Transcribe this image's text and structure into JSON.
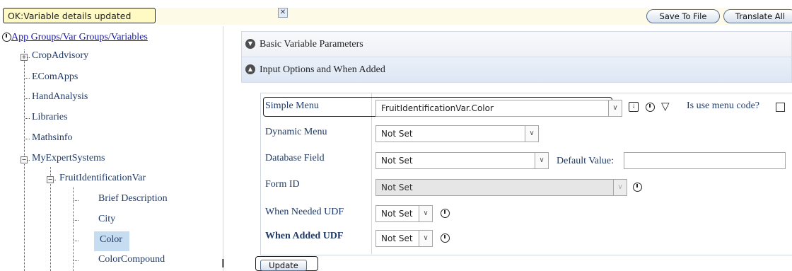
{
  "status": {
    "message": "OK:Variable details updated",
    "close_icon": "close-icon",
    "save_to_file": "Save To File",
    "translate_all": "Translate All"
  },
  "tree": {
    "title": "App Groups/Var Groups/Variables",
    "title_icon": "refresh-icon",
    "groups": [
      "CropAdvisory",
      "EComApps",
      "HandAnalysis",
      "Libraries",
      "Mathsinfo",
      "MyExpertSystems"
    ],
    "subgroup": "FruitIdentificationVar",
    "variables": [
      "Brief Description",
      "City",
      "Color",
      "ColorCompound"
    ],
    "selected": "Color"
  },
  "accordion": {
    "basic": "Basic Variable Parameters",
    "input": "Input Options and When Added"
  },
  "form": {
    "simple_menu": {
      "label": "Simple Menu",
      "value": "FruitIdentificationVar.Color"
    },
    "use_menu_code": "Is use menu code?",
    "dynamic_menu": {
      "label": "Dynamic Menu",
      "value": "Not Set"
    },
    "database_field": {
      "label": "Database Field",
      "value": "Not Set"
    },
    "default_value": {
      "label": "Default Value:",
      "value": ""
    },
    "form_id": {
      "label": "Form ID",
      "value": "Not Set"
    },
    "when_needed": {
      "label": "When Needed UDF",
      "value": "Not Set"
    },
    "when_added": {
      "label": "When Added UDF",
      "value": "Not Set"
    },
    "update": "Update"
  }
}
